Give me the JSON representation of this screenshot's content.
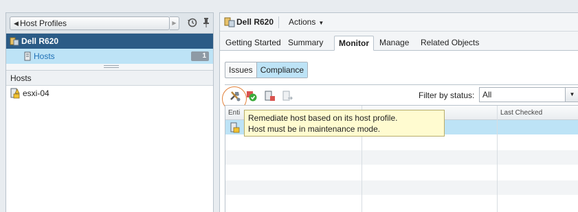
{
  "left_panel": {
    "back_button_label": "Host Profiles",
    "object_title": "Dell R620",
    "hosts_item": {
      "label": "Hosts",
      "count": "1"
    },
    "section_title": "Hosts",
    "hosts": [
      {
        "name": "esxi-04"
      }
    ]
  },
  "right_panel": {
    "object_title": "Dell R620",
    "actions_label": "Actions",
    "tabs": [
      {
        "label": "Getting Started"
      },
      {
        "label": "Summary"
      },
      {
        "label": "Monitor",
        "active": true
      },
      {
        "label": "Manage"
      },
      {
        "label": "Related Objects"
      }
    ],
    "subtabs": [
      {
        "label": "Issues"
      },
      {
        "label": "Compliance",
        "active": true
      }
    ],
    "filter": {
      "label": "Filter by status:",
      "value": "All"
    },
    "grid": {
      "columns": [
        "Enti",
        "Last Checked"
      ]
    }
  },
  "tooltip": {
    "line1": "Remediate host based on its host profile.",
    "line2": "Host must be in maintenance mode."
  },
  "colors": {
    "selection": "#bde3f6",
    "title_bar": "#2b5b86",
    "highlight_circle": "#e2813a",
    "tooltip_bg": "#fffbd0"
  }
}
